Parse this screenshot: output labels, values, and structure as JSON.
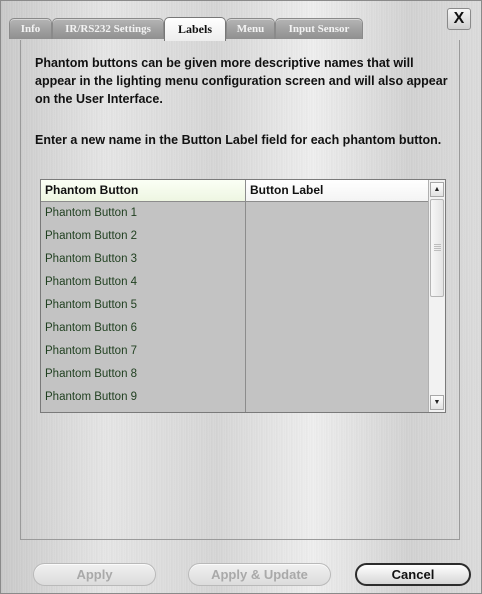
{
  "window": {
    "close_label": "X"
  },
  "tabs": [
    {
      "label": "Info",
      "active": false
    },
    {
      "label": "IR/RS232 Settings",
      "active": false
    },
    {
      "label": "Labels",
      "active": true
    },
    {
      "label": "Menu",
      "active": false
    },
    {
      "label": "Input Sensor",
      "active": false
    }
  ],
  "description": {
    "paragraph1": "Phantom buttons can be given more descriptive names that will appear in the lighting menu configuration screen and will also appear on the User Interface.",
    "paragraph2": "Enter a new name in the Button Label field for each phantom button."
  },
  "table": {
    "columns": [
      "Phantom Button",
      "Button Label"
    ],
    "rows": [
      {
        "phantom": "Phantom Button 1",
        "label": ""
      },
      {
        "phantom": "Phantom Button 2",
        "label": ""
      },
      {
        "phantom": "Phantom Button 3",
        "label": ""
      },
      {
        "phantom": "Phantom Button 4",
        "label": ""
      },
      {
        "phantom": "Phantom Button 5",
        "label": ""
      },
      {
        "phantom": "Phantom Button 6",
        "label": ""
      },
      {
        "phantom": "Phantom Button 7",
        "label": ""
      },
      {
        "phantom": "Phantom Button 8",
        "label": ""
      },
      {
        "phantom": "Phantom Button 9",
        "label": ""
      }
    ],
    "scroll_up_icon": "arrow-up-icon",
    "scroll_down_icon": "arrow-down-icon"
  },
  "buttons": {
    "apply": {
      "label": "Apply",
      "enabled": false
    },
    "apply_update": {
      "label": "Apply & Update",
      "enabled": false
    },
    "cancel": {
      "label": "Cancel",
      "enabled": true
    }
  }
}
